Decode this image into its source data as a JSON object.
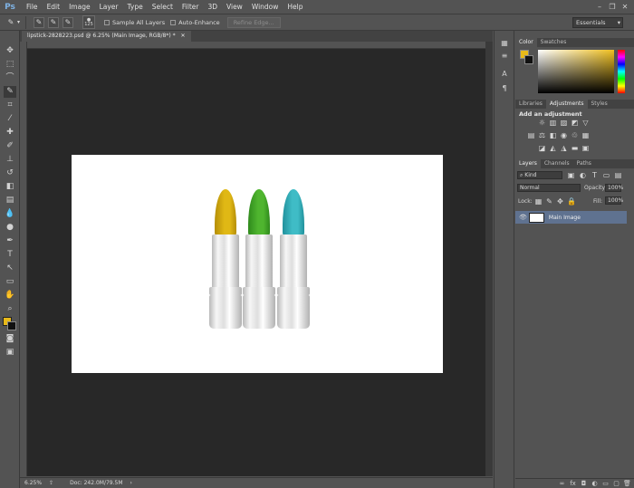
{
  "app": {
    "logo": "Ps"
  },
  "menu": [
    "File",
    "Edit",
    "Image",
    "Layer",
    "Type",
    "Select",
    "Filter",
    "3D",
    "View",
    "Window",
    "Help"
  ],
  "options_bar": {
    "sample_all_layers": "Sample All Layers",
    "auto_enhance": "Auto-Enhance",
    "refine_edge": "Refine Edge...",
    "brush_size": "125",
    "workspace": "Essentials"
  },
  "document": {
    "tab_title": "lipstick-2828223.psd @ 6.25% (Main Image, RGB/8*) *",
    "zoom": "6.25%",
    "doc_size": "Doc: 242.0M/79.5M",
    "lipsticks": [
      {
        "color": "#e0b815",
        "shade": "#b58e07"
      },
      {
        "color": "#4fb52f",
        "shade": "#2f8a1c"
      },
      {
        "color": "#3fbcc6",
        "shade": "#21919c"
      }
    ]
  },
  "colors": {
    "foreground": "#e8b919",
    "background": "#111111"
  },
  "panels": {
    "color_tabs": [
      "Color",
      "Swatches"
    ],
    "adjust_tabs": [
      "Libraries",
      "Adjustments",
      "Styles"
    ],
    "adjust_title": "Add an adjustment",
    "layers_tabs": [
      "Layers",
      "Channels",
      "Paths"
    ],
    "filter_kind": "Kind",
    "blend_mode": "Normal",
    "opacity_label": "Opacity:",
    "opacity": "100%",
    "lock_label": "Lock:",
    "fill_label": "Fill:",
    "fill": "100%",
    "layer_name": "Main Image"
  }
}
